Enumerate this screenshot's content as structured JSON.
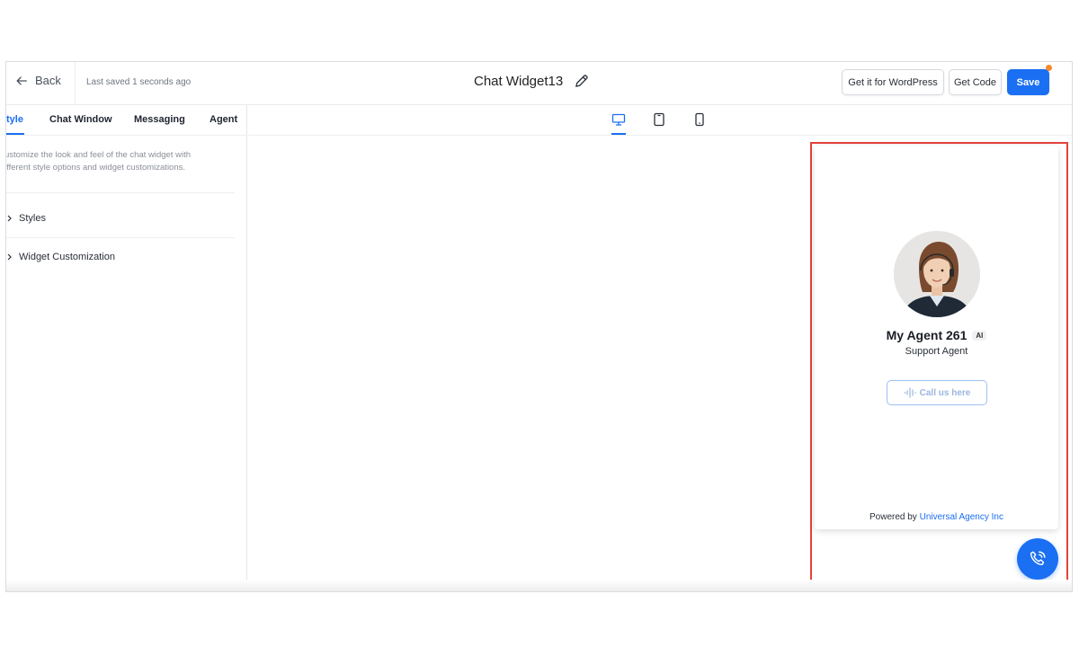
{
  "header": {
    "back_label": "Back",
    "saved_text": "Last saved 1 seconds ago",
    "title": "Chat Widget13",
    "wordpress_button": "Get it for WordPress",
    "code_button": "Get Code",
    "save_button": "Save"
  },
  "left_panel": {
    "tabs": [
      "tyle",
      "Chat Window",
      "Messaging",
      "Agent"
    ],
    "active_tab": "tyle",
    "description_line1": "ustomize the look and feel of the chat widget with",
    "description_line2": "ifferent style options and widget customizations.",
    "sections": [
      "Styles",
      "Widget Customization"
    ]
  },
  "device_bar": {
    "devices": [
      "desktop-icon",
      "tablet-icon",
      "mobile-icon"
    ],
    "active_device": "desktop"
  },
  "preview": {
    "agent_name": "My Agent 261",
    "ai_badge": "AI",
    "agent_role": "Support Agent",
    "call_button": "Call us here",
    "powered_by_prefix": "Powered by",
    "powered_by_link": "Universal Agency Inc"
  },
  "colors": {
    "accent": "#1a6ff2",
    "highlight_border": "#e3423a",
    "notification_dot": "#f58a2c"
  }
}
